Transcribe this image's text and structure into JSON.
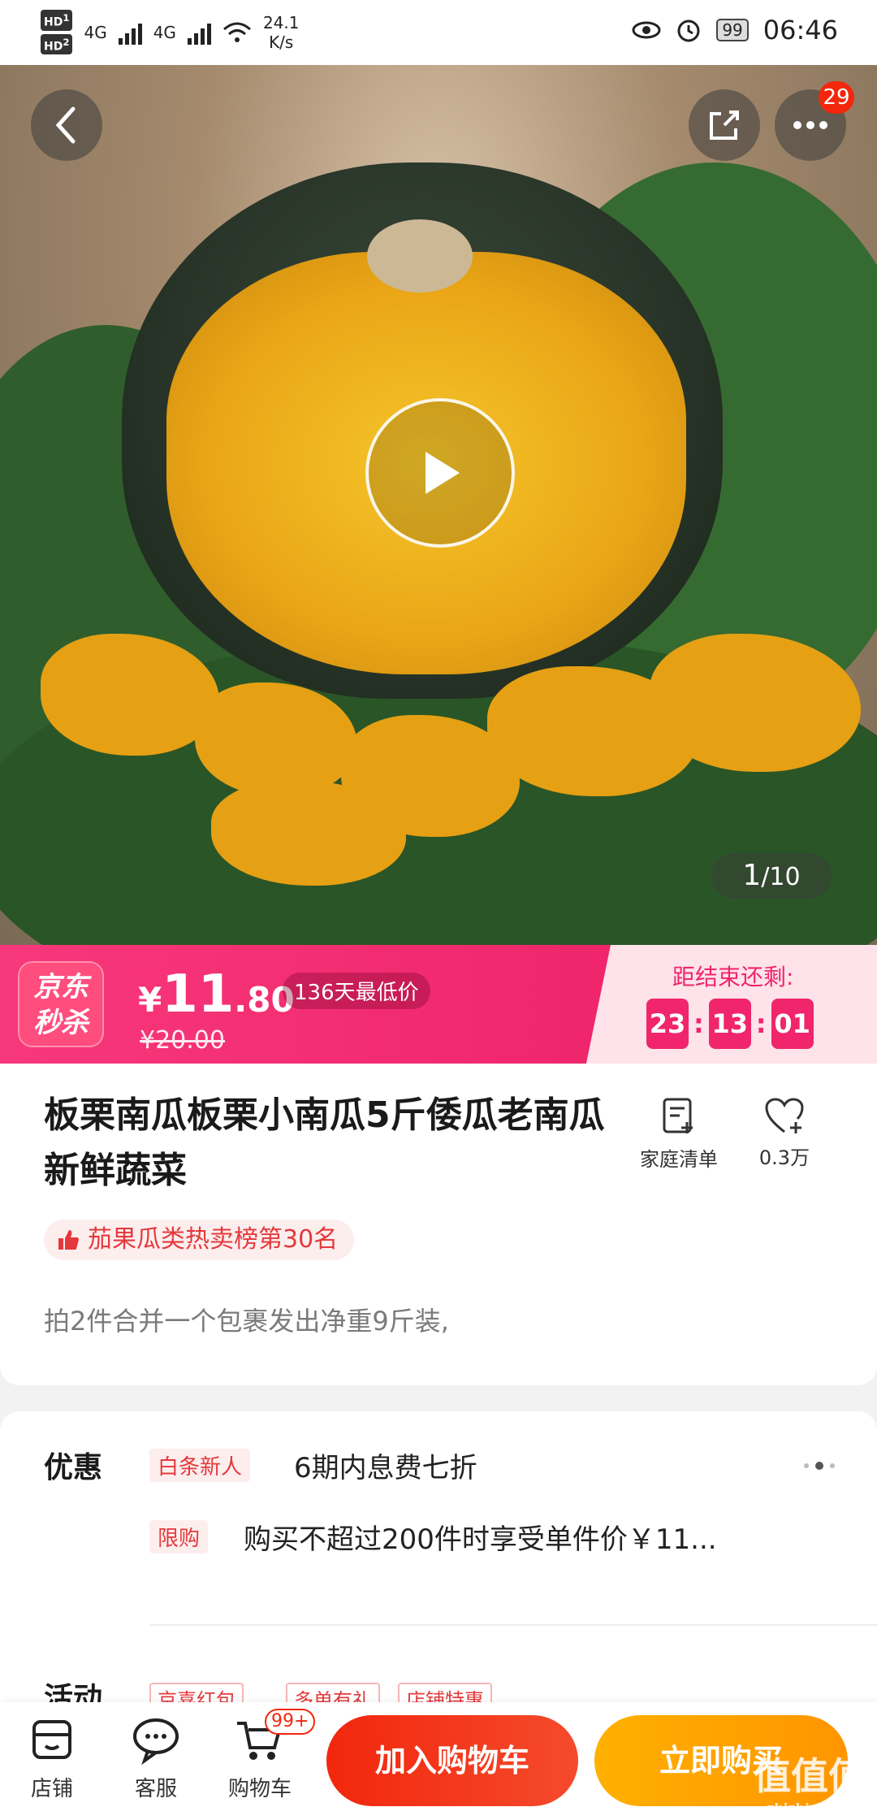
{
  "status_bar": {
    "sim1": "HD",
    "sim1_index": "1",
    "sim2": "HD",
    "sim2_index": "2",
    "net1": "4G",
    "net2": "4G",
    "speed": "24.1",
    "speed_unit": "K/s",
    "battery": "99",
    "time": "06:46"
  },
  "hero": {
    "more_badge": "29",
    "image_index": "1",
    "image_total": "/10"
  },
  "seckill": {
    "logo_line1": "京东",
    "logo_line2": "秒杀",
    "price_symbol": "¥",
    "price_int": "11",
    "price_dec": ".80",
    "low_price_tag": "136天最低价",
    "original_price": "¥20.00",
    "countdown_label": "距结束还剩:",
    "hours": "23",
    "minutes": "13",
    "seconds": "01"
  },
  "product": {
    "title": "板栗南瓜板栗小南瓜5斤倭瓜老南瓜新鲜蔬菜",
    "family_list_label": "家庭清单",
    "favorites_count": "0.3万",
    "rank_badge": "茄果瓜类热卖榜第30名",
    "description": "拍2件合并一个包裹发出净重9斤装,"
  },
  "offers": {
    "label": "优惠",
    "row1_tag": "白条新人",
    "row1_text": "6期内息费七折",
    "row2_tag": "限购",
    "row2_text": "购买不超过200件时享受单件价￥11...",
    "activity_label": "活动",
    "activity_tags": [
      "京喜红包",
      "多单有礼",
      "店铺特惠"
    ]
  },
  "bottom_bar": {
    "store": "店铺",
    "service": "客服",
    "cart": "购物车",
    "cart_badge": "99+",
    "add_to_cart": "加入购物车",
    "buy_now": "立即购买"
  },
  "watermark": {
    "text": "值值值",
    "sub": "zhizhizhi.com"
  },
  "colors": {
    "brand_red": "#f2270c",
    "seckill_pink": "#f0256c",
    "buy_orange": "#ff9f00"
  }
}
